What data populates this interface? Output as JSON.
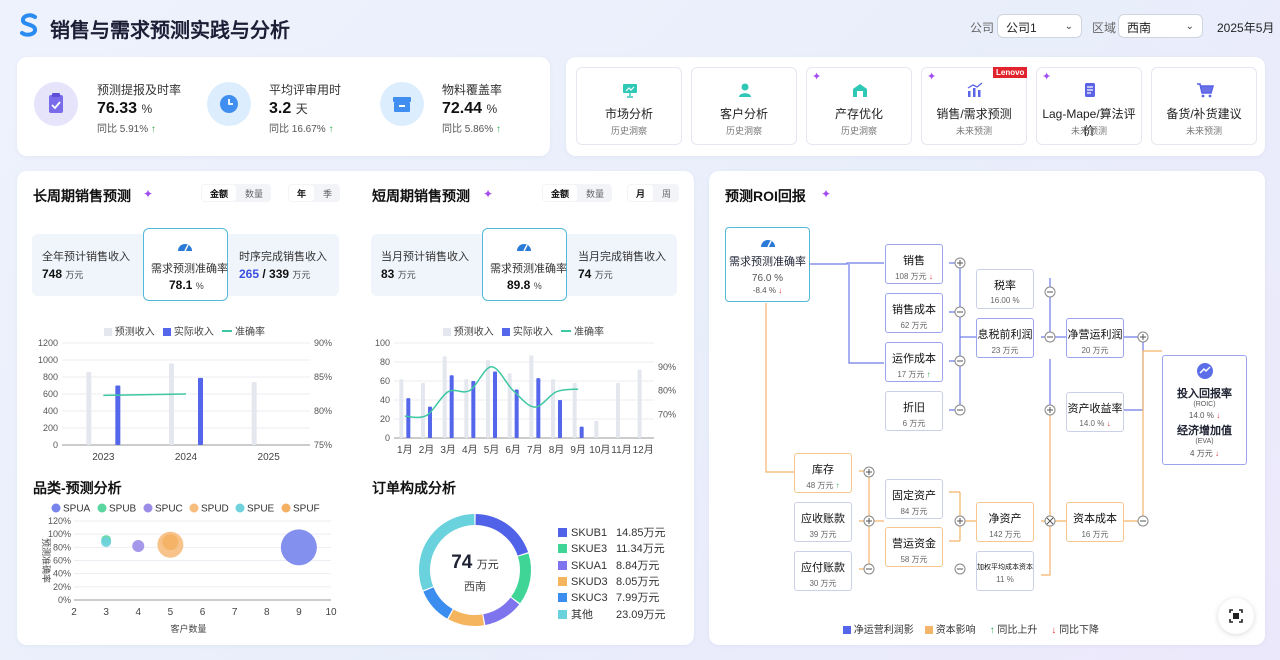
{
  "header": {
    "title": "销售与需求预测实践与分析",
    "company_label": "公司",
    "company_value": "公司1",
    "region_label": "区域",
    "region_value": "西南",
    "date": "2025年5月"
  },
  "kpis": [
    {
      "name": "预测提报及时率",
      "value": "76.33",
      "unit": "%",
      "yoy_label": "同比",
      "yoy": "5.91%",
      "trend": "up",
      "icon": "clipboard-icon"
    },
    {
      "name": "平均评审用时",
      "value": "3.2",
      "unit": "天",
      "yoy_label": "同比",
      "yoy": "16.67%",
      "trend": "up",
      "icon": "clock-icon"
    },
    {
      "name": "物料覆盖率",
      "value": "72.44",
      "unit": "%",
      "yoy_label": "同比",
      "yoy": "5.86%",
      "trend": "up",
      "icon": "box-icon"
    }
  ],
  "nav": [
    {
      "name": "市场分析",
      "sub": "历史洞察",
      "icon": "presentation-icon"
    },
    {
      "name": "客户分析",
      "sub": "历史洞察",
      "icon": "user-icon"
    },
    {
      "name": "产存优化",
      "sub": "历史洞察",
      "icon": "warehouse-icon",
      "spark": true
    },
    {
      "name": "销售/需求预测",
      "sub": "未来预测",
      "icon": "chart-trend-icon",
      "spark": true,
      "badge": "Lenovo"
    },
    {
      "name": "Lag-Mape/算法评价",
      "sub": "未来预测",
      "icon": "checklist-icon",
      "spark": true
    },
    {
      "name": "备货/补货建议",
      "sub": "未来预测",
      "icon": "cart-icon"
    }
  ],
  "long": {
    "title": "长周期销售预测",
    "seg1": [
      "金额",
      "数量"
    ],
    "seg2": [
      "年",
      "季"
    ],
    "s1_name": "全年预计销售收入",
    "s1_val": "748",
    "s1_unit": "万元",
    "s2_name": "需求预测准确率",
    "s2_val": "78.1",
    "s2_unit": "%",
    "s3_name": "时序完成销售收入",
    "s3_val_a": "265",
    "s3_sep": " / ",
    "s3_val_b": "339",
    "s3_unit": "万元",
    "legend": [
      "预测收入",
      "实际收入",
      "准确率"
    ]
  },
  "short": {
    "title": "短周期销售预测",
    "seg1": [
      "金额",
      "数量"
    ],
    "seg2": [
      "月",
      "周"
    ],
    "s1_name": "当月预计销售收入",
    "s1_val": "83",
    "s1_unit": "万元",
    "s2_name": "需求预测准确率",
    "s2_val": "89.8",
    "s2_unit": "%",
    "s3_name": "当月完成销售收入",
    "s3_val": "74",
    "s3_unit": "万元",
    "legend": [
      "预测收入",
      "实际收入",
      "准确率"
    ]
  },
  "chart_data": [
    {
      "type": "bar",
      "name": "long-cycle",
      "categories": [
        "2023",
        "2024",
        "2025"
      ],
      "series": [
        {
          "name": "预测收入",
          "values": [
            860,
            960,
            740
          ]
        },
        {
          "name": "实际收入",
          "values": [
            700,
            790,
            null
          ]
        },
        {
          "name": "准确率",
          "values": [
            82.3,
            82.5,
            null
          ]
        }
      ],
      "yticks_left": [
        "0",
        "200",
        "400",
        "600",
        "800",
        "1000",
        "1200"
      ],
      "yticks_right": [
        "75%",
        "80%",
        "85%",
        "90%"
      ],
      "ylim": [
        0,
        1200
      ],
      "ylim_right": [
        75,
        90
      ]
    },
    {
      "type": "bar",
      "name": "short-cycle",
      "categories": [
        "1月",
        "2月",
        "3月",
        "4月",
        "5月",
        "6月",
        "7月",
        "8月",
        "9月",
        "10月",
        "11月",
        "12月"
      ],
      "series": [
        {
          "name": "预测收入",
          "values": [
            62,
            58,
            86,
            62,
            82,
            68,
            87,
            62,
            58,
            18,
            58,
            72
          ]
        },
        {
          "name": "实际收入",
          "values": [
            42,
            33,
            66,
            60,
            70,
            51,
            63,
            40,
            12,
            null,
            null,
            null
          ]
        },
        {
          "name": "准确率",
          "values": [
            69.2,
            69.5,
            79.5,
            80,
            90,
            80,
            73,
            79.5,
            80.6,
            null,
            null,
            null
          ]
        }
      ],
      "yticks_left": [
        "0",
        "20",
        "40",
        "60",
        "80",
        "100"
      ],
      "yticks_right": [
        "70%",
        "80%",
        "90%"
      ],
      "ylim": [
        0,
        100
      ],
      "ylim_right": [
        60,
        100
      ]
    },
    {
      "type": "scatter",
      "name": "category-analysis",
      "title": "品类-预测分析",
      "xlabel": "客户数量",
      "ylabel": "预测准确率",
      "xticks": [
        "2",
        "3",
        "4",
        "5",
        "6",
        "7",
        "8",
        "9",
        "10"
      ],
      "yticks": [
        "0%",
        "20%",
        "40%",
        "60%",
        "80%",
        "100%",
        "120%"
      ],
      "series": [
        {
          "name": "SPUA",
          "color": "#7784ec",
          "x": 9,
          "y": 80,
          "size": 18
        },
        {
          "name": "SPUB",
          "color": "#5ad6a0",
          "x": 3,
          "y": 91,
          "size": 5
        },
        {
          "name": "SPUC",
          "color": "#9b8ce8",
          "x": 4,
          "y": 82,
          "size": 6
        },
        {
          "name": "SPUD",
          "color": "#f7bd7d",
          "x": 5,
          "y": 84,
          "size": 13
        },
        {
          "name": "SPUE",
          "color": "#6fd2dd",
          "x": 3,
          "y": 88,
          "size": 5
        },
        {
          "name": "SPUF",
          "color": "#f4b163",
          "x": 5,
          "y": 88,
          "size": 8
        }
      ]
    },
    {
      "type": "pie",
      "name": "order-composition",
      "title": "订单构成分析",
      "center_value": "74",
      "center_unit": "万元",
      "center_label": "西南",
      "slices": [
        {
          "name": "SKUB1",
          "label": "14.85万元",
          "value": 14.85,
          "color": "#4f62e8"
        },
        {
          "name": "SKUE3",
          "label": "11.34万元",
          "value": 11.34,
          "color": "#3ed596"
        },
        {
          "name": "SKUA1",
          "label": "8.84万元",
          "value": 8.84,
          "color": "#7d74ee"
        },
        {
          "name": "SKUD3",
          "label": "8.05万元",
          "value": 8.05,
          "color": "#f5b45e"
        },
        {
          "name": "SKUC3",
          "label": "7.99万元",
          "value": 7.99,
          "color": "#3b8df0"
        },
        {
          "name": "其他",
          "label": "23.09万元",
          "value": 23.09,
          "color": "#6ad2dc"
        }
      ]
    }
  ],
  "roi": {
    "title": "预测ROI回报",
    "root": {
      "name": "需求预测准确率",
      "value": "76.0 %",
      "change": "-8.4 %",
      "trend": "down"
    },
    "nodes": {
      "sales": {
        "name": "销售",
        "value": "108 万元",
        "trend": "down"
      },
      "cost": {
        "name": "销售成本",
        "value": "62 万元"
      },
      "opcost": {
        "name": "运作成本",
        "value": "17 万元",
        "trend": "up"
      },
      "dep": {
        "name": "折旧",
        "value": "6 万元"
      },
      "tax": {
        "name": "税率",
        "value": "16.00 %"
      },
      "ebit": {
        "name": "息税前利润",
        "value": "23 万元"
      },
      "nopat": {
        "name": "净营运利润",
        "value": "20 万元"
      },
      "assetyield": {
        "name": "资产收益率",
        "value": "14.0 %",
        "trend": "down"
      },
      "result1": {
        "name": "投入回报率",
        "sub": "(ROIC)",
        "value": "14.0 %",
        "trend": "down"
      },
      "result2": {
        "name": "经济增加值",
        "sub": "(EVA)",
        "value": "4 万元",
        "trend": "down"
      },
      "inventory": {
        "name": "库存",
        "value": "48 万元",
        "trend": "up"
      },
      "fixed": {
        "name": "固定资产",
        "value": "84 万元"
      },
      "ar": {
        "name": "应收账款",
        "value": "39 万元"
      },
      "wc": {
        "name": "营运资金",
        "value": "58 万元"
      },
      "ap": {
        "name": "应付账款",
        "value": "30 万元"
      },
      "netassets": {
        "name": "净资产",
        "value": "142 万元"
      },
      "wacc": {
        "name": "加权平均成本资本",
        "value": "11 %"
      },
      "capcost": {
        "name": "资本成本",
        "value": "16 万元"
      }
    },
    "legend": [
      "净运营利润影",
      "资本影响",
      "同比上升",
      "同比下降"
    ]
  },
  "colors": {
    "forecast": "#e4e7ee",
    "actual": "#5466ea",
    "accuracy": "#3ec7a3",
    "blue_flow": "#6d7ae6",
    "orange_flow": "#f3b56a"
  }
}
